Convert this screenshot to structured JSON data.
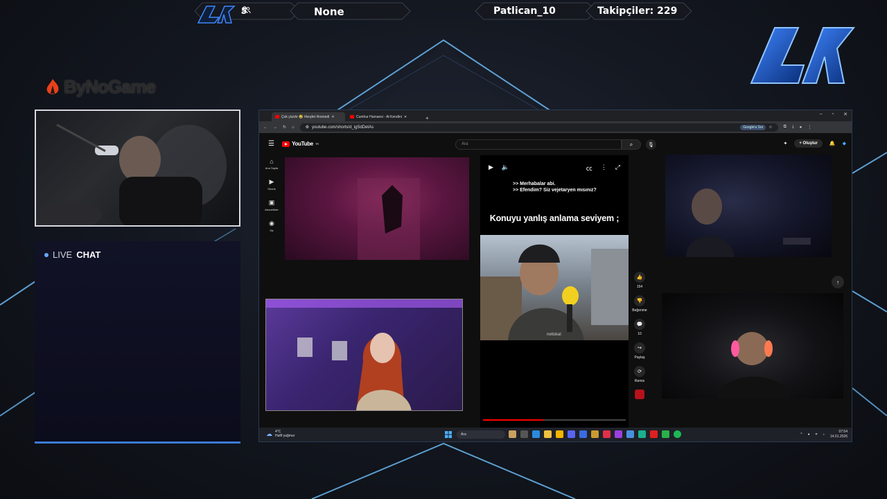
{
  "topbar": {
    "viewers_count": "5",
    "game": "None",
    "username": "Patlican_10",
    "followers": "Takipçiler: 229"
  },
  "sponsor": "ByNoGame",
  "livechat": {
    "live": "LIVE",
    "chat": "CHAT"
  },
  "browser": {
    "tabs": [
      {
        "title": "Çok yüzdır 😂 #keşfet #komedi"
      },
      {
        "title": "Cumhur Hamansi - At Kendini"
      }
    ],
    "new_tab": "+",
    "url": "youtube.com/shorts/d_igSdDetAs",
    "google_btn": "Google'a Sor"
  },
  "youtube": {
    "logo": "YouTube",
    "logo_sup": "TR",
    "search_placeholder": "Ara",
    "create_label": "Oluştur",
    "sidebar": [
      {
        "icon": "home-icon",
        "label": "Ana Sayfa"
      },
      {
        "icon": "shorts-icon",
        "label": "Shorts"
      },
      {
        "icon": "subscriptions-icon",
        "label": "Abonelikler"
      },
      {
        "icon": "you-icon",
        "label": "Siz"
      }
    ],
    "short": {
      "dialog_line1": ">> Merhabalar abi.",
      "dialog_line2": ">> Efendim? Siz vejetaryen mısınız?",
      "caption": "Konuyu yanlış anlama seviyem ;",
      "watermark": "netlokal",
      "progress_percent": 42
    },
    "actions": [
      {
        "name": "like",
        "label": "154"
      },
      {
        "name": "dislike",
        "label": "Beğenme"
      },
      {
        "name": "comments",
        "label": "10"
      },
      {
        "name": "share",
        "label": "Paylaş"
      },
      {
        "name": "remix",
        "label": "Remix"
      }
    ]
  },
  "taskbar": {
    "temp": "4°C",
    "weather": "Hafif yağmur",
    "search": "Ara",
    "time": "07:54",
    "date": "14.01.2026"
  },
  "colors": {
    "accent": "#3b7bd6",
    "yt_red": "#ff0000",
    "brand_blue": "#2f6fe0"
  }
}
